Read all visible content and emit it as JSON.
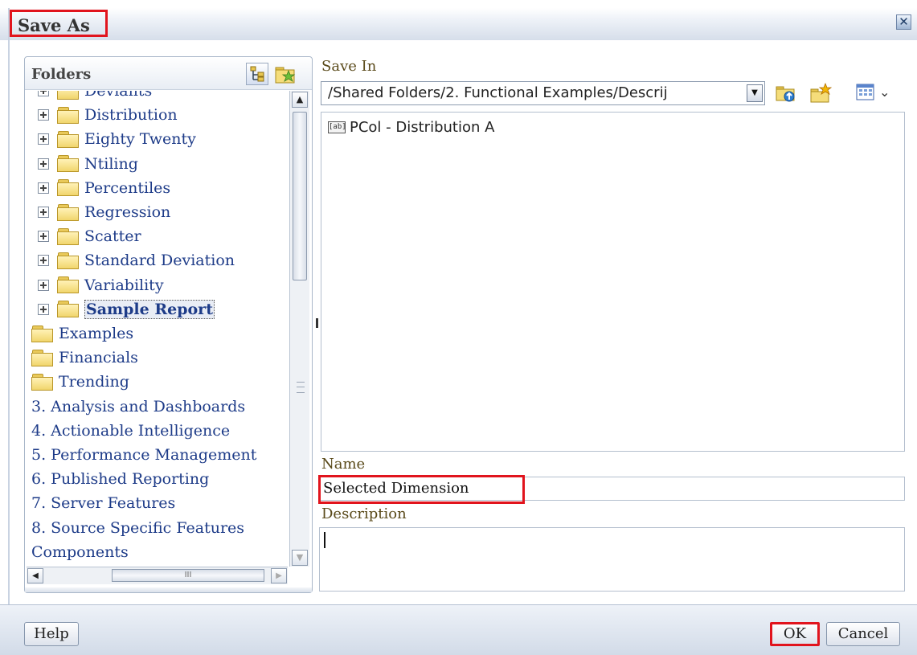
{
  "dialog": {
    "title": "Save As",
    "close_glyph": "✕"
  },
  "folders": {
    "title": "Folders",
    "tree_rows": [
      {
        "label": "Deviants",
        "expander": true,
        "folder": true,
        "indent": 1,
        "partial": true
      },
      {
        "label": "Distribution",
        "expander": true,
        "folder": true,
        "indent": 1
      },
      {
        "label": "Eighty Twenty",
        "expander": true,
        "folder": true,
        "indent": 1
      },
      {
        "label": "Ntiling",
        "expander": true,
        "folder": true,
        "indent": 1
      },
      {
        "label": "Percentiles",
        "expander": true,
        "folder": true,
        "indent": 1
      },
      {
        "label": "Regression",
        "expander": true,
        "folder": true,
        "indent": 1
      },
      {
        "label": "Scatter",
        "expander": true,
        "folder": true,
        "indent": 1
      },
      {
        "label": "Standard Deviation",
        "expander": true,
        "folder": true,
        "indent": 1
      },
      {
        "label": "Variability",
        "expander": true,
        "folder": true,
        "indent": 1
      },
      {
        "label": "Sample Report",
        "expander": true,
        "folder": true,
        "indent": 1,
        "selected": true
      },
      {
        "label": "Examples",
        "expander": false,
        "folder": true,
        "indent": 0
      },
      {
        "label": "Financials",
        "expander": false,
        "folder": true,
        "indent": 0
      },
      {
        "label": "Trending",
        "expander": false,
        "folder": true,
        "indent": 0
      },
      {
        "label": "3. Analysis and Dashboards",
        "expander": false,
        "folder": false,
        "indent": 0
      },
      {
        "label": "4. Actionable Intelligence",
        "expander": false,
        "folder": false,
        "indent": 0
      },
      {
        "label": "5. Performance Management",
        "expander": false,
        "folder": false,
        "indent": 0
      },
      {
        "label": "6. Published Reporting",
        "expander": false,
        "folder": false,
        "indent": 0
      },
      {
        "label": "7. Server Features",
        "expander": false,
        "folder": false,
        "indent": 0
      },
      {
        "label": "8. Source Specific Features",
        "expander": false,
        "folder": false,
        "indent": 0
      },
      {
        "label": "Components",
        "expander": false,
        "folder": false,
        "indent": 0
      }
    ],
    "hscroll_thumb_text": "III"
  },
  "save_in": {
    "label": "Save In",
    "path": "/Shared Folders/2. Functional Examples/Descrij",
    "chevron": "⌄"
  },
  "files": [
    {
      "icon_text": "[ab]",
      "label": "PCol - Distribution A"
    }
  ],
  "name": {
    "label": "Name",
    "value": "Selected Dimension"
  },
  "description": {
    "label": "Description",
    "value": ""
  },
  "footer": {
    "help_label": "Help",
    "ok_label": "OK",
    "cancel_label": "Cancel"
  },
  "colors": {
    "highlight_box": "#e1141d",
    "tree_link": "#1d3b88",
    "label_brown": "#5a4a1a"
  }
}
